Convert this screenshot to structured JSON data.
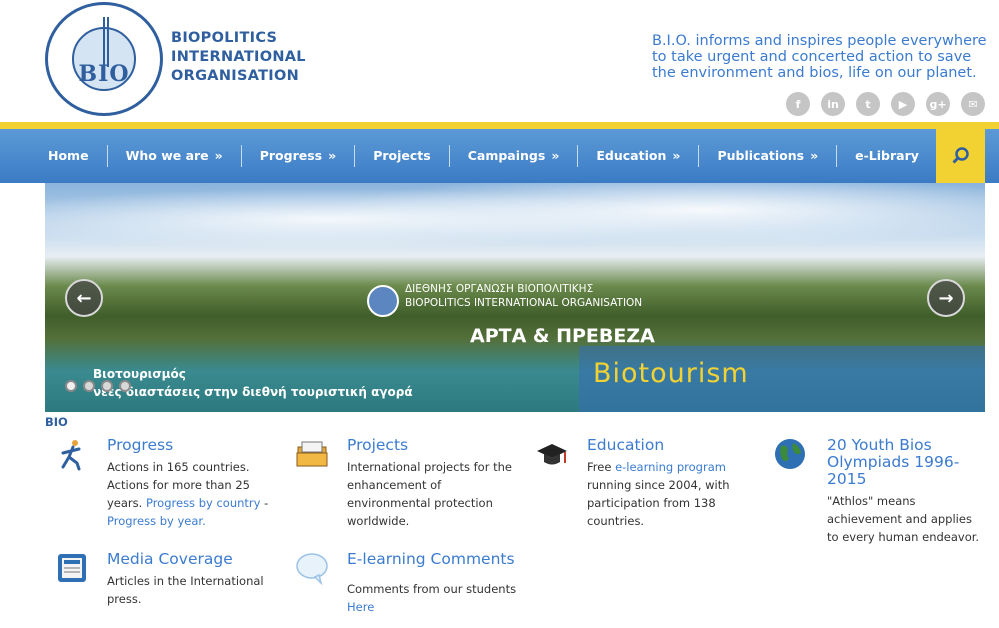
{
  "header": {
    "org_name": [
      "BIOPOLITICS",
      "INTERNATIONAL",
      "ORGANISATION"
    ],
    "logo_text": "BIO",
    "tagline": "B.I.O. informs and inspires people everywhere to take urgent and concerted action to save the environment and bios, life on our planet."
  },
  "social": [
    {
      "icon": "facebook-icon",
      "glyph": "f"
    },
    {
      "icon": "linkedin-icon",
      "glyph": "in"
    },
    {
      "icon": "twitter-icon",
      "glyph": "t"
    },
    {
      "icon": "youtube-icon",
      "glyph": "▶"
    },
    {
      "icon": "googleplus-icon",
      "glyph": "g+"
    },
    {
      "icon": "email-icon",
      "glyph": "✉"
    }
  ],
  "nav": {
    "items": [
      {
        "label": "Home",
        "arrow": ""
      },
      {
        "label": "Who we are",
        "arrow": "»"
      },
      {
        "label": "Progress",
        "arrow": "»"
      },
      {
        "label": "Projects",
        "arrow": ""
      },
      {
        "label": "Campaings",
        "arrow": "»"
      },
      {
        "label": "Education",
        "arrow": "»"
      },
      {
        "label": "Publications",
        "arrow": "»"
      },
      {
        "label": "e-Library",
        "arrow": ""
      }
    ]
  },
  "slider": {
    "org_greek": "ΔΙΕΘΝΗΣ ΟΡΓΑΝΩΣΗ ΒΙΟΠΟΛΙΤΙΚΗΣ",
    "org_english": "BIOPOLITICS INTERNATIONAL ORGANISATION",
    "place": "ΑΡΤΑ & ΠΡΕΒΕΖΑ",
    "caption_line1": "Βιοτουρισμός",
    "caption_line2": "νέες διαστάσεις στην διεθνή τουριστική αγορά",
    "title": "Biotourism",
    "prev_glyph": "←",
    "next_glyph": "→",
    "slide_count": 4,
    "active_slide": 1
  },
  "section_label": "BIO",
  "features": {
    "progress": {
      "title": "Progress",
      "text": "Actions in 165 countries. Actions for more than 25 years.",
      "link1": "Progress by country",
      "sep": " - ",
      "link2": "Progress by year."
    },
    "projects": {
      "title": "Projects",
      "text": "International projects for the enhancement of environmental protection worldwide."
    },
    "education": {
      "title": "Education",
      "pre": "Free ",
      "link": "e-learning program",
      "text": " running since 2004, with participation from 138 countries."
    },
    "olympiads": {
      "title": "20 Youth Bios Olympiads 1996-2015",
      "text": "\"Athlos\" means achievement and applies to every human endeavor."
    },
    "media": {
      "title": "Media Coverage",
      "text": "Articles in the International press."
    },
    "comments": {
      "title": "E-learning Comments",
      "text": "Comments from our students ",
      "link": "Here"
    }
  }
}
